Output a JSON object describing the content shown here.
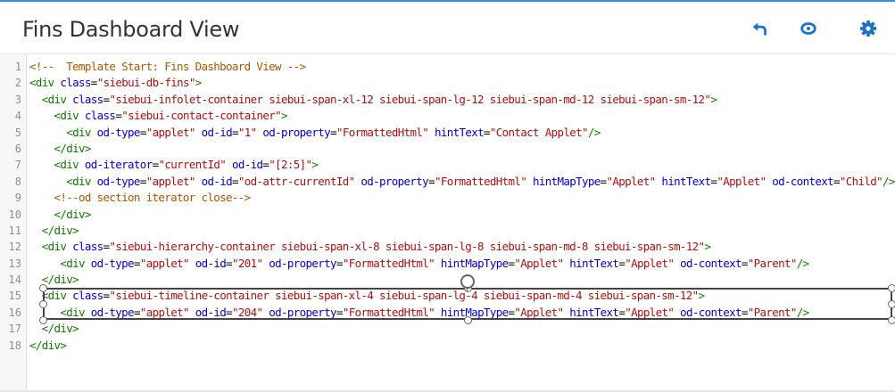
{
  "header": {
    "title": "Fins Dashboard View",
    "accent_color": "#1a73c9",
    "actions": [
      {
        "icon": "undo-icon",
        "label": "Undo"
      },
      {
        "icon": "eye-icon",
        "label": "Preview"
      },
      {
        "icon": "gear-icon",
        "label": "Settings"
      }
    ]
  },
  "editor": {
    "line_numbers": [
      "1",
      "2",
      "3",
      "4",
      "5",
      "6",
      "7",
      "8",
      "9",
      "10",
      "11",
      "12",
      "13",
      "14",
      "15",
      "16",
      "17",
      "18"
    ],
    "lines": [
      "<!--  Template Start: Fins Dashboard View -->",
      "<div class=\"siebui-db-fins\">",
      "  <div class=\"siebui-infolet-container siebui-span-xl-12 siebui-span-lg-12 siebui-span-md-12 siebui-span-sm-12\">",
      "    <div class=\"siebui-contact-container\">",
      "      <div od-type=\"applet\" od-id=\"1\" od-property=\"FormattedHtml\" hintText=\"Contact Applet\"/>",
      "    </div>",
      "    <div od-iterator=\"currentId\" od-id=\"[2:5]\">",
      "      <div od-type=\"applet\" od-id=\"od-attr-currentId\" od-property=\"FormattedHtml\" hintMapType=\"Applet\" hintText=\"Applet\" od-context=\"Child\"/>",
      "    <!--od section iterator close-->",
      "    </div>",
      "  </div>",
      "  <div class=\"siebui-hierarchy-container siebui-span-xl-8 siebui-span-lg-8 siebui-span-md-8 siebui-span-sm-12\">",
      "     <div od-type=\"applet\" od-id=\"201\" od-property=\"FormattedHtml\" hintMapType=\"Applet\" hintText=\"Applet\" od-context=\"Parent\"/>",
      "  </div>",
      "  <div class=\"siebui-timeline-container siebui-span-xl-4 siebui-span-lg-4 siebui-span-md-4 siebui-span-sm-12\">",
      "     <div od-type=\"applet\" od-id=\"204\" od-property=\"FormattedHtml\" hintMapType=\"Applet\" hintText=\"Applet\" od-context=\"Parent\"/>",
      "  </div>",
      "</div>"
    ]
  }
}
